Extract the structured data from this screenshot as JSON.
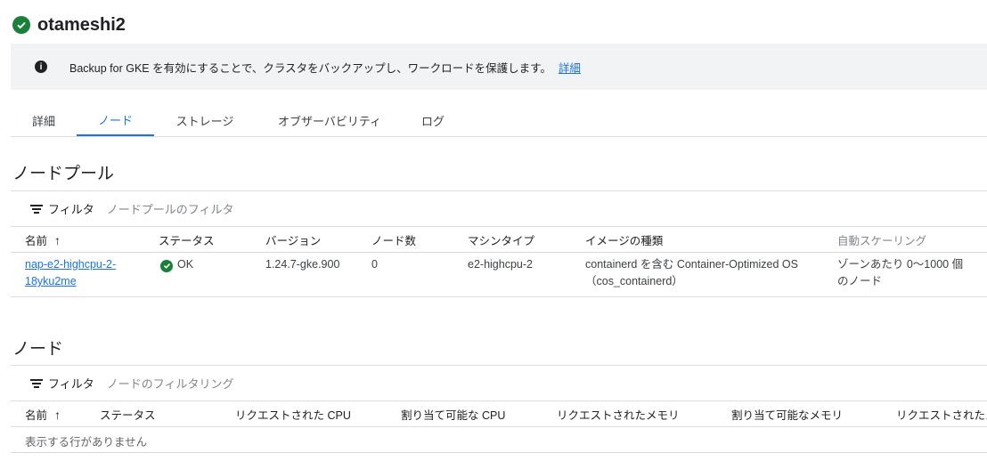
{
  "header": {
    "title": "otameshi2"
  },
  "banner": {
    "message": "Backup for GKE を有効にすることで、クラスタをバックアップし、ワークロードを保護します。",
    "link": "詳細"
  },
  "tabs": [
    {
      "label": "詳細"
    },
    {
      "label": "ノード"
    },
    {
      "label": "ストレージ"
    },
    {
      "label": "オブザーバビリティ"
    },
    {
      "label": "ログ"
    }
  ],
  "node_pools": {
    "title": "ノードプール",
    "filter_label": "フィルタ",
    "filter_placeholder": "ノードプールのフィルタ",
    "columns": [
      "名前",
      "ステータス",
      "バージョン",
      "ノード数",
      "マシンタイプ",
      "イメージの種類",
      "自動スケーリング"
    ],
    "rows": [
      {
        "name_line1": "nap-e2-highcpu-2-",
        "name_line2": "18yku2me",
        "status": "OK",
        "version": "1.24.7-gke.900",
        "node_count": "0",
        "machine_type": "e2-highcpu-2",
        "image_line1": "containerd を含む Container-Optimized OS",
        "image_line2": "（cos_containerd）",
        "autoscaling_line1": "ゾーンあたり 0〜1000 個",
        "autoscaling_line2": "のノード"
      }
    ]
  },
  "nodes": {
    "title": "ノード",
    "filter_label": "フィルタ",
    "filter_placeholder": "ノードのフィルタリング",
    "columns": [
      "名前",
      "ステータス",
      "リクエストされた CPU",
      "割り当て可能な CPU",
      "リクエストされたメモリ",
      "割り当て可能なメモリ",
      "リクエストされたス"
    ],
    "empty_message": "表示する行がありません"
  },
  "colors": {
    "accent": "#1a73e8",
    "success": "#188038",
    "banner_bg": "#f1f3f4"
  }
}
